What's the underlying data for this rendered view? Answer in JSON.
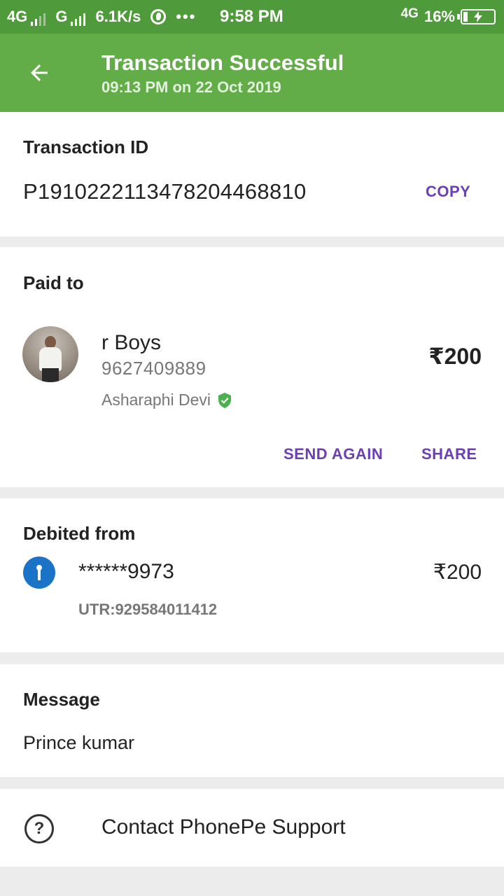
{
  "status_bar": {
    "net1": "4G",
    "net2": "G",
    "speed": "6.1K/s",
    "dots": "•••",
    "time": "9:58 PM",
    "net3": "4G",
    "battery": "16%"
  },
  "header": {
    "title": "Transaction Successful",
    "subtitle": "09:13 PM on 22 Oct 2019",
    "back_icon": "arrow-back-icon",
    "bg_color": "#62ad48"
  },
  "transaction": {
    "label": "Transaction ID",
    "id": "P1910222113478204468810",
    "copy_label": "COPY"
  },
  "paid_to": {
    "label": "Paid to",
    "name": "r Boys",
    "phone": "9627409889",
    "holder": "Asharaphi Devi",
    "verified_icon": "verified-shield-icon",
    "amount": "₹200",
    "send_again_label": "SEND AGAIN",
    "share_label": "SHARE"
  },
  "debited_from": {
    "label": "Debited from",
    "bank_icon": "sbi-bank-icon",
    "account": "******9973",
    "amount": "₹200",
    "utr": "UTR:929584011412"
  },
  "message": {
    "label": "Message",
    "text": "Prince kumar"
  },
  "support": {
    "icon": "help-circle-icon",
    "label": "Contact PhonePe Support"
  },
  "colors": {
    "accent": "#6c3fb5",
    "status_bar": "#4f9a3b",
    "verified": "#4caf50"
  }
}
